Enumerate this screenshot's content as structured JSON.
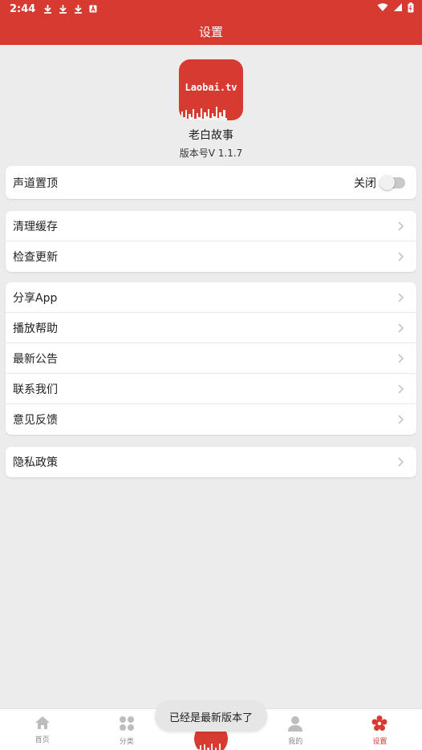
{
  "status": {
    "time": "2:44",
    "icons_left": [
      "download-icon",
      "download-icon",
      "download-icon",
      "app-notify-icon"
    ],
    "icons_right": [
      "wifi-icon",
      "signal-icon",
      "battery-icon"
    ]
  },
  "header": {
    "title": "设置"
  },
  "app": {
    "logo_text": "Laobai.tv",
    "name": "老白故事",
    "version": "版本号V 1.1.7"
  },
  "groups": {
    "channel_top": {
      "label": "声道置顶",
      "toggle_text": "关闭",
      "toggle_on": false
    },
    "maintenance": [
      {
        "label": "清理缓存"
      },
      {
        "label": "检查更新"
      }
    ],
    "misc": [
      {
        "label": "分享App"
      },
      {
        "label": "播放帮助"
      },
      {
        "label": "最新公告"
      },
      {
        "label": "联系我们"
      },
      {
        "label": "意见反馈"
      }
    ],
    "privacy": [
      {
        "label": "隐私政策"
      }
    ]
  },
  "nav": [
    {
      "label": "首页",
      "icon": "home-icon"
    },
    {
      "label": "分类",
      "icon": "category-icon"
    },
    {
      "label": "",
      "icon": "center-play-icon"
    },
    {
      "label": "我的",
      "icon": "user-icon"
    },
    {
      "label": "设置",
      "icon": "settings-icon",
      "active": true
    }
  ],
  "toast": {
    "text": "已经是最新版本了"
  },
  "colors": {
    "accent": "#d63a31",
    "background": "#ececec"
  }
}
